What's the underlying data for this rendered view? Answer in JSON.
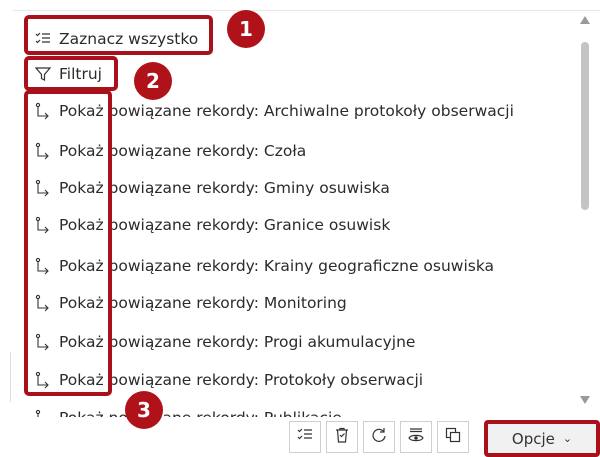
{
  "menu": {
    "select_all": "Zaznacz wszystko",
    "filter": "Filtruj",
    "items": [
      "Pokaż powiązane rekordy: Archiwalne protokoły obserwacji",
      "Pokaż powiązane rekordy: Czoła",
      "Pokaż powiązane rekordy: Gminy osuwiska",
      "Pokaż powiązane rekordy: Granice osuwisk",
      "Pokaż powiązane rekordy: Krainy geograficzne osuwiska",
      "Pokaż powiązane rekordy: Monitoring",
      "Pokaż powiązane rekordy: Progi akumulacyjne",
      "Pokaż powiązane rekordy: Protokoły obserwacji",
      "Pokaż powiązane rekordy: Publikacje"
    ]
  },
  "badges": [
    "1",
    "2",
    "3"
  ],
  "toolbar": {
    "options_label": "Opcje",
    "icons": [
      "select-all-icon",
      "clear-selection-icon",
      "refresh-icon",
      "show-selected-icon",
      "copy-icon"
    ]
  },
  "colors": {
    "highlight": "#a8101a",
    "badge": "#b01219"
  }
}
